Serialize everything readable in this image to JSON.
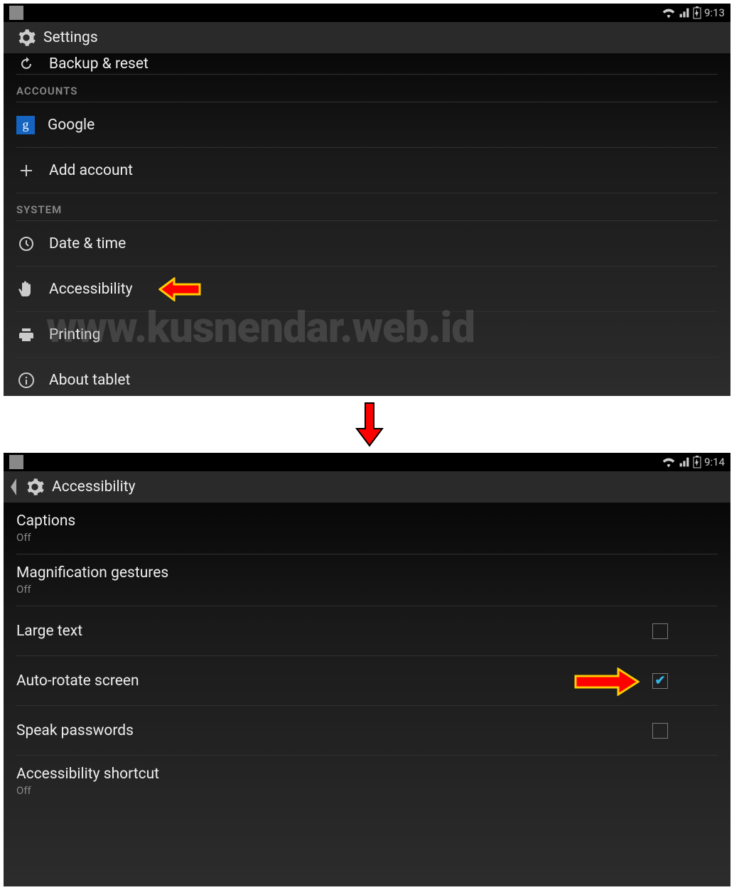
{
  "watermark": "www.kusnendar.web.id",
  "screen1": {
    "status_time": "9:13",
    "actionbar_title": "Settings",
    "truncated_top": "Backup & reset",
    "sections": {
      "accounts_header": "ACCOUNTS",
      "google": "Google",
      "add_account": "Add account",
      "system_header": "SYSTEM",
      "date_time": "Date & time",
      "accessibility": "Accessibility",
      "printing": "Printing",
      "about": "About tablet"
    }
  },
  "screen2": {
    "status_time": "9:14",
    "actionbar_title": "Accessibility",
    "prefs": {
      "captions": {
        "title": "Captions",
        "sub": "Off"
      },
      "magnification": {
        "title": "Magnification gestures",
        "sub": "Off"
      },
      "large_text": {
        "title": "Large text"
      },
      "auto_rotate": {
        "title": "Auto-rotate screen"
      },
      "speak_passwords": {
        "title": "Speak passwords"
      },
      "a11y_shortcut": {
        "title": "Accessibility shortcut",
        "sub": "Off"
      }
    }
  }
}
